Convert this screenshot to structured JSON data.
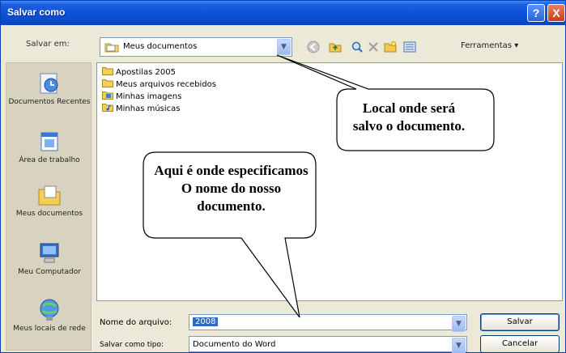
{
  "title": "Salvar como",
  "title_buttons": {
    "help": "?",
    "close": "X"
  },
  "save_in": {
    "label": "Salvar em:",
    "value": "Meus documentos"
  },
  "toolbar": {
    "tools_label": "Ferramentas ▾"
  },
  "places": [
    {
      "label": "Documentos Recentes",
      "icon": "recent-documents-icon"
    },
    {
      "label": "Área de trabalho",
      "icon": "desktop-icon"
    },
    {
      "label": "Meus documentos",
      "icon": "my-documents-icon"
    },
    {
      "label": "Meu Computador",
      "icon": "my-computer-icon"
    },
    {
      "label": "Meus locais de rede",
      "icon": "network-places-icon"
    }
  ],
  "files": [
    {
      "name": "Apostilas 2005",
      "icon": "folder-icon"
    },
    {
      "name": "Meus arquivos recebidos",
      "icon": "folder-icon"
    },
    {
      "name": "Minhas imagens",
      "icon": "pictures-folder-icon"
    },
    {
      "name": "Minhas músicas",
      "icon": "music-folder-icon"
    }
  ],
  "file_name": {
    "label": "Nome do arquivo:",
    "value": "2008"
  },
  "file_type": {
    "label": "Salvar como tipo:",
    "value": "Documento do Word"
  },
  "buttons": {
    "save": "Salvar",
    "cancel": "Cancelar"
  },
  "callouts": {
    "location": "Local onde será salvo o documento.",
    "name": "Aqui é onde especificamos O nome do nosso documento."
  },
  "colors": {
    "titlebar": "#0c4fd6",
    "selection": "#316ac5",
    "dialog_bg": "#ece9d8"
  }
}
